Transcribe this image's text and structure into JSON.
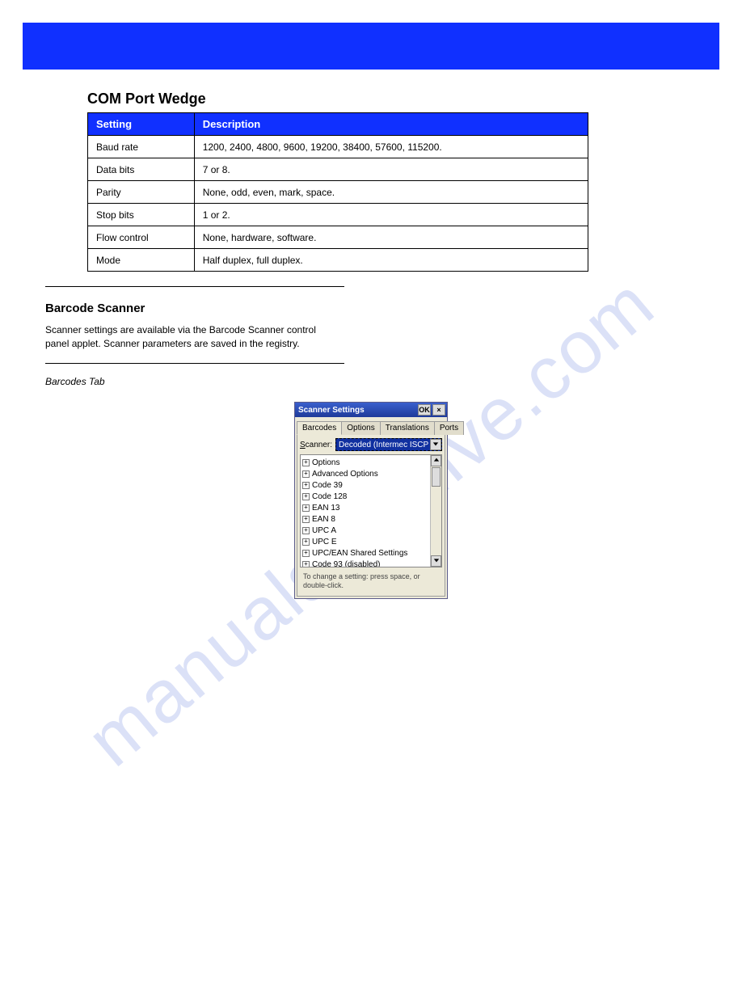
{
  "watermark": "manualsarchive.com",
  "section": {
    "title": "COM Port Wedge",
    "table": {
      "headers": [
        "Setting",
        "Description"
      ],
      "rows": [
        [
          "Baud rate",
          "1200, 2400, 4800, 9600, 19200, 38400, 57600, 115200."
        ],
        [
          "Data bits",
          "7 or 8."
        ],
        [
          "Parity",
          "None, odd, even, mark, space."
        ],
        [
          "Stop bits",
          "1 or 2."
        ],
        [
          "Flow control",
          "None, hardware, software."
        ],
        [
          "Mode",
          "Half duplex, full duplex."
        ]
      ]
    }
  },
  "barcode": {
    "title": "Barcode Scanner",
    "intro": "Scanner settings are available via the Barcode Scanner control panel applet. Scanner parameters are saved in the registry.",
    "tab_heading": "Barcodes Tab"
  },
  "dialog": {
    "title": "Scanner Settings",
    "ok": "OK",
    "tabs": [
      "Barcodes",
      "Options",
      "Translations",
      "Ports"
    ],
    "scanner_label_ul": "S",
    "scanner_label_rest": "canner:",
    "scanner_value": "Decoded (Intermec ISCP",
    "tree": [
      "Options",
      "Advanced Options",
      "Code 39",
      "Code 128",
      "EAN 13",
      "EAN 8",
      "UPC A",
      "UPC E",
      "UPC/EAN Shared Settings",
      "Code 93 (disabled)"
    ],
    "hint": "To change a setting: press space, or double-click."
  }
}
